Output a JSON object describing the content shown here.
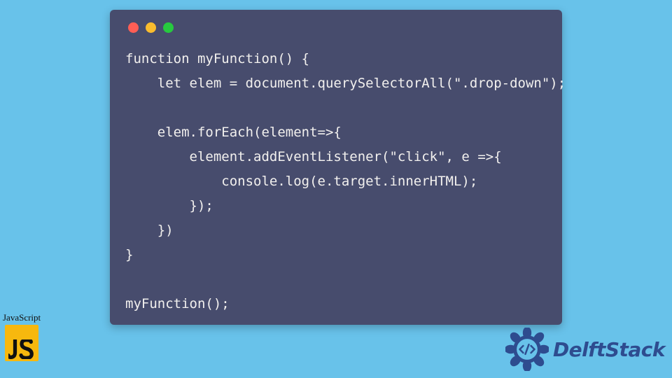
{
  "code": {
    "lines": [
      "function myFunction() {",
      "    let elem = document.querySelectorAll(\".drop-down\");",
      "",
      "    elem.forEach(element=>{",
      "        element.addEventListener(\"click\", e =>{",
      "            console.log(e.target.innerHTML);",
      "        });",
      "    })",
      "}",
      "",
      "myFunction();"
    ]
  },
  "badge": {
    "label": "JavaScript",
    "tile_text": "JS"
  },
  "brand": {
    "name": "DelftStack"
  },
  "colors": {
    "page_bg": "#68c2ea",
    "card_bg": "#474c6d",
    "code_fg": "#f2f0ee",
    "badge_tile": "#f7b80e",
    "brand_fg": "#2e4c8f"
  }
}
